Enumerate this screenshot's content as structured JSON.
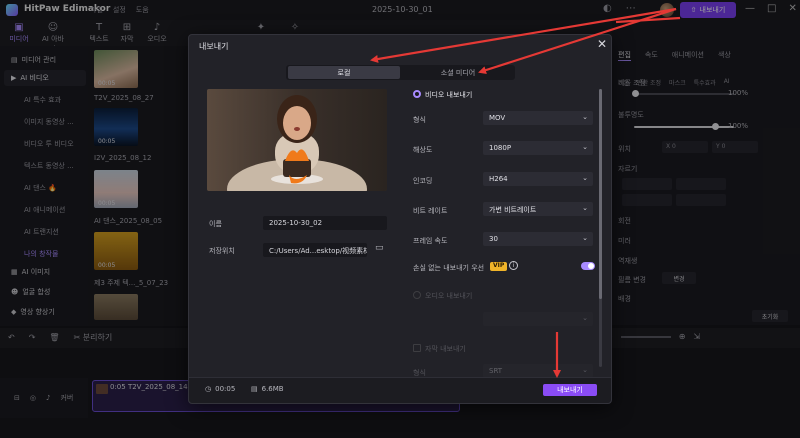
{
  "titlebar": {
    "app_name": "HitPaw Edimakor",
    "menu": [
      "파일",
      "설정",
      "도움"
    ],
    "project_name": "2025-10-30_01",
    "export_label": "내보내기",
    "window_controls": [
      "—",
      "□",
      "✕"
    ]
  },
  "toolbar": [
    {
      "label": "미디어",
      "icon": "media-icon"
    },
    {
      "label": "AI 아바타",
      "icon": "avatar-icon"
    },
    {
      "label": "텍스트",
      "icon": "text-icon"
    },
    {
      "label": "자막",
      "icon": "subtitle-icon"
    },
    {
      "label": "오디오",
      "icon": "audio-icon"
    }
  ],
  "sidebar": {
    "items": [
      {
        "label": "미디어 관리",
        "sub": false
      },
      {
        "label": "AI 비디오",
        "sub": false
      },
      {
        "label": "AI 특수 효과",
        "sub": true
      },
      {
        "label": "이미지 동영상 ...",
        "sub": true
      },
      {
        "label": "비디오 투 비디오",
        "sub": true
      },
      {
        "label": "텍스트 동영상 ...",
        "sub": true
      },
      {
        "label": "AI 댄스 🔥",
        "sub": true
      },
      {
        "label": "AI 애니메이션",
        "sub": true
      },
      {
        "label": "AI 트랜지션",
        "sub": true
      },
      {
        "label": "나의 창작물",
        "sub": true
      },
      {
        "label": "AI 이미지",
        "sub": false
      },
      {
        "label": "얼굴 합성",
        "sub": false
      },
      {
        "label": "영상 향상기",
        "sub": false
      }
    ]
  },
  "media": {
    "items": [
      {
        "label": "T2V_2025_08_27",
        "duration": "00:05"
      },
      {
        "label": "I2V_2025_08_12",
        "duration": "00:05"
      },
      {
        "label": "AI 댄스_2025_08_05",
        "duration": "00:05"
      },
      {
        "label": "제3 주제 텍..._5_07_23",
        "duration": "00:05"
      },
      {
        "label": "",
        "duration": ""
      }
    ]
  },
  "props": {
    "tabs": [
      "편집",
      "속도",
      "애니메이션",
      "색상"
    ],
    "subtabs": [
      "기본",
      "변환 조정",
      "마스크",
      "특수효과",
      "AI"
    ],
    "labels": [
      "비율 조정",
      "불투명도",
      "위치",
      "X",
      "0",
      "Y",
      "0",
      "자르기",
      "회전",
      "미러",
      "역재생",
      "필름 변경",
      "배경"
    ],
    "percent_1": "100%",
    "percent_2": "100%",
    "reset_label": "초기화",
    "change_label": "변경"
  },
  "timeline": {
    "toolbar": [
      "↶",
      "↷",
      "🗑",
      "✂ 분리하기"
    ],
    "clip_label": "0:05 T2V_2025_08_14",
    "track_head_label": "커버"
  },
  "dialog": {
    "title": "내보내기",
    "segment": {
      "local": "로컬",
      "social": "소셜 미디어"
    },
    "video_export_label": "비디오 내보내기",
    "name_label": "이름",
    "name_value": "2025-10-30_02",
    "save_label": "저장위치",
    "save_value": "C:/Users/Ad...esktop/视频素材",
    "fields": [
      {
        "label": "형식",
        "value": "MOV"
      },
      {
        "label": "해상도",
        "value": "1080P"
      },
      {
        "label": "인코딩",
        "value": "H264"
      },
      {
        "label": "비트 레이트",
        "value": "가변 비트레이트"
      },
      {
        "label": "프레임 속도",
        "value": "30"
      }
    ],
    "lossless_label": "손실 없는 내보내기 우선",
    "vip_label": "VIP",
    "audio_export_label": "오디오 내보내기",
    "audio_format_value": "",
    "audio_bitrate_value": "",
    "subtitle_export_label": "자막 내보내기",
    "subtitle_format_label": "형식",
    "subtitle_format_value": "SRT",
    "duration": "00:05",
    "filesize": "6.6MB",
    "export_button": "내보내기"
  },
  "colors": {
    "accent": "#8a4cf5",
    "annotation": "#e53935"
  }
}
